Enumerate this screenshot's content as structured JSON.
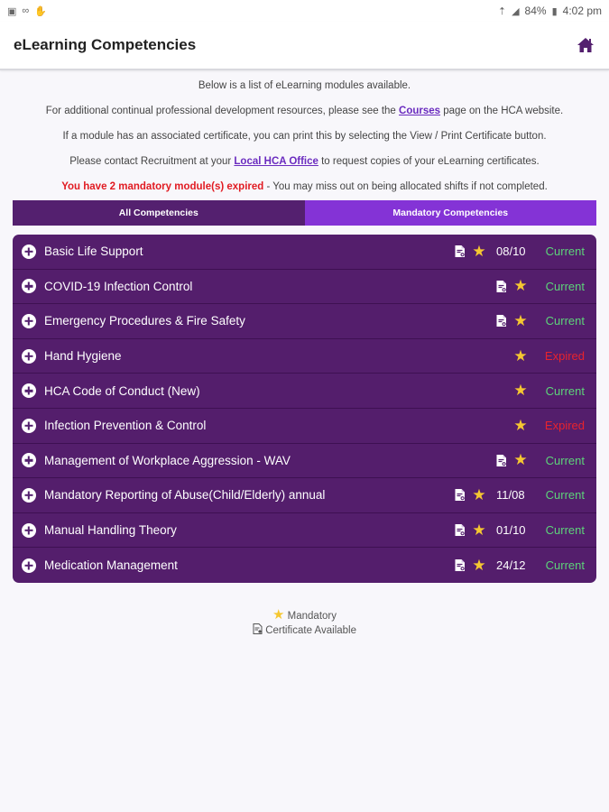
{
  "status_bar": {
    "battery": "84%",
    "time": "4:02 pm"
  },
  "header": {
    "title": "eLearning Competencies"
  },
  "intro": {
    "line1": "Below is a list of eLearning modules available.",
    "line2_pre": "For additional continual professional development resources, please see the ",
    "line2_link": "Courses",
    "line2_post": " page on the HCA website.",
    "line3": "If a module has an associated certificate, you can print this by selecting the View / Print Certificate button.",
    "line4_pre": "Please contact Recruitment at your ",
    "line4_link": "Local HCA Office",
    "line4_post": " to request copies of your eLearning certificates.",
    "warning_strong": "You have 2 mandatory module(s) expired",
    "warning_rest": " - You may miss out on being allocated shifts if not completed."
  },
  "tabs": {
    "all": "All Competencies",
    "mandatory": "Mandatory Competencies"
  },
  "modules": [
    {
      "name": "Basic Life Support",
      "certificate": true,
      "mandatory": true,
      "date": "08/10",
      "status": "Current"
    },
    {
      "name": "COVID-19 Infection Control",
      "certificate": true,
      "mandatory": true,
      "date": "",
      "status": "Current"
    },
    {
      "name": "Emergency Procedures & Fire Safety",
      "certificate": true,
      "mandatory": true,
      "date": "",
      "status": "Current"
    },
    {
      "name": "Hand Hygiene",
      "certificate": false,
      "mandatory": true,
      "date": "",
      "status": "Expired"
    },
    {
      "name": "HCA Code of Conduct (New)",
      "certificate": false,
      "mandatory": true,
      "date": "",
      "status": "Current"
    },
    {
      "name": "Infection Prevention & Control",
      "certificate": false,
      "mandatory": true,
      "date": "",
      "status": "Expired"
    },
    {
      "name": "Management of Workplace Aggression - WAV",
      "certificate": true,
      "mandatory": true,
      "date": "",
      "status": "Current"
    },
    {
      "name": "Mandatory Reporting of Abuse(Child/Elderly) annual",
      "certificate": true,
      "mandatory": true,
      "date": "11/08",
      "status": "Current"
    },
    {
      "name": "Manual Handling Theory",
      "certificate": true,
      "mandatory": true,
      "date": "01/10",
      "status": "Current"
    },
    {
      "name": "Medication Management",
      "certificate": true,
      "mandatory": true,
      "date": "24/12",
      "status": "Current"
    }
  ],
  "legend": {
    "mandatory": "Mandatory",
    "certificate": "Certificate Available"
  },
  "colors": {
    "primary": "#54206f",
    "accent": "#8433d6",
    "current": "#5dd37a",
    "expired": "#e8232d",
    "star": "#f5c731"
  }
}
